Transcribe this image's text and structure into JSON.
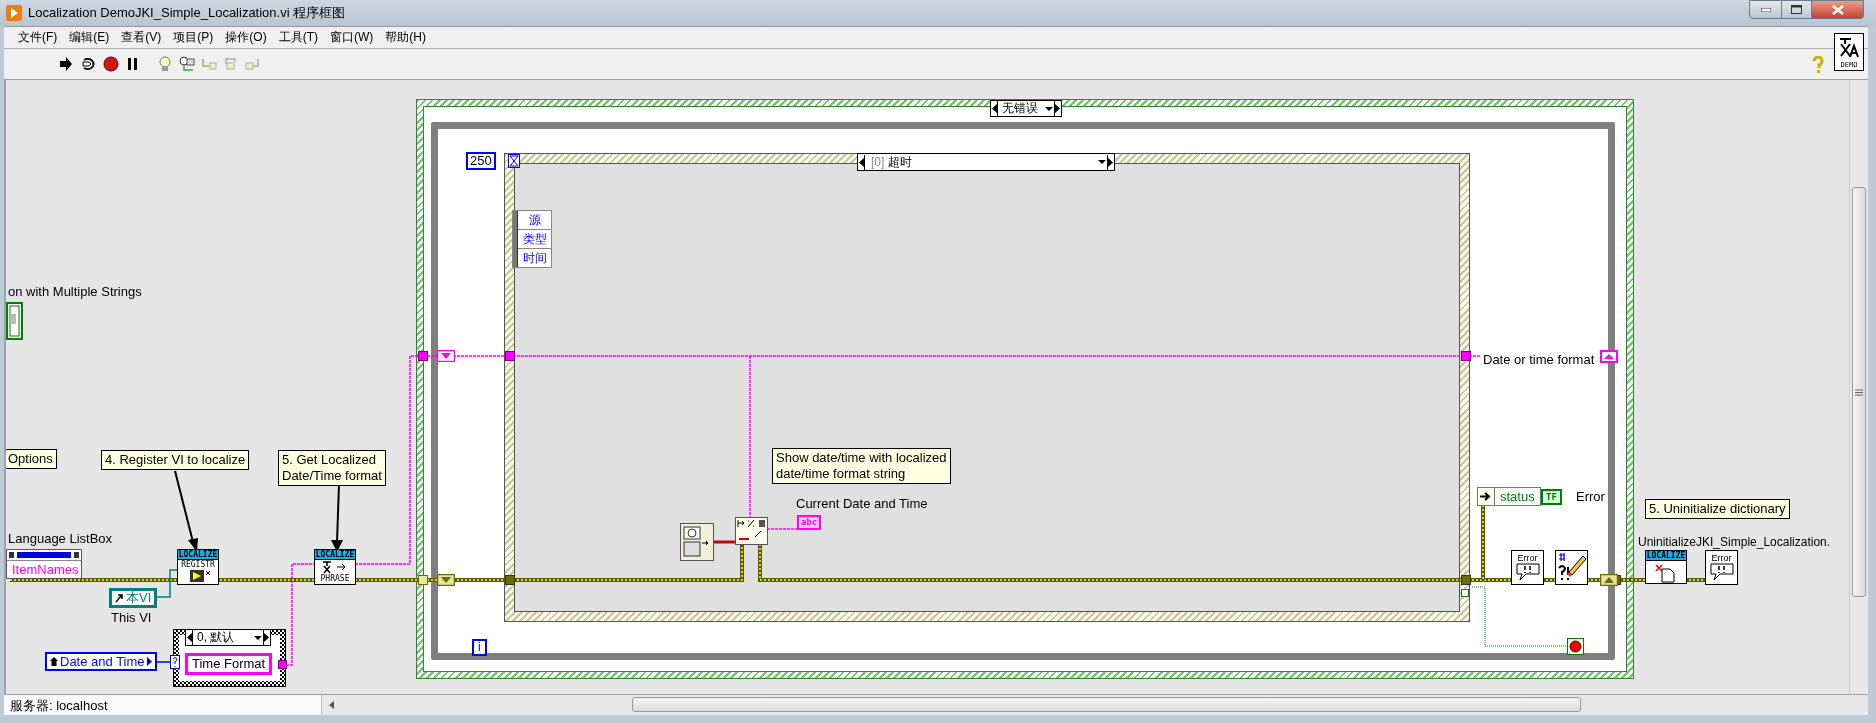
{
  "window": {
    "title": "Localization DemoJKI_Simple_Localization.vi 程序框图"
  },
  "menu": [
    {
      "label": "文件(F)"
    },
    {
      "label": "编辑(E)"
    },
    {
      "label": "查看(V)"
    },
    {
      "label": "项目(P)"
    },
    {
      "label": "操作(O)"
    },
    {
      "label": "工具(T)"
    },
    {
      "label": "窗口(W)"
    },
    {
      "label": "帮助(H)"
    }
  ],
  "vi_icon": {
    "caption": "DEMO"
  },
  "diagram": {
    "case_structure": {
      "selector": "无错误"
    },
    "while_loop": {
      "iteration": "i"
    },
    "event_structure": {
      "timeout": "250",
      "case_index": "[0]",
      "case_name": "超时",
      "event_data": [
        "源",
        "类型",
        "时间"
      ]
    },
    "partial_label": "on with Multiple Strings",
    "comments": [
      {
        "text": "Options"
      },
      {
        "text": "4. Register VI to localize"
      },
      {
        "text": "5. Get Localized\nDate/Time format"
      },
      {
        "text": "Show date/time with localized\ndate/time format string"
      },
      {
        "text": "5. Uninitialize dictionary"
      }
    ],
    "listbox_property": {
      "label": "Language ListBox",
      "property": "ItemNames"
    },
    "vi_reference": {
      "value": "本VI",
      "label": "This VI"
    },
    "date_time_control": {
      "label": "Date and Time"
    },
    "enum_case": {
      "selector": "0, 默认",
      "string": "Time Format"
    },
    "register_node": {
      "banner": "LOCALIZE",
      "caption": "REGISTR"
    },
    "phrase_node": {
      "banner": "LOCALIZE",
      "caption": "PHRASE"
    },
    "current_time_indicator": {
      "label": "Current Date and Time",
      "type": "abc"
    },
    "format_indicator": {
      "label": "Date or time format"
    },
    "unbundle": {
      "field": "status"
    },
    "error_indicator": {
      "type": "TF",
      "label": "Error"
    },
    "error_dialogs": [
      {
        "text": "Error"
      },
      {
        "text": "Error"
      }
    ],
    "uninit_node": {
      "label": "UninitializeJKI_Simple_Localization.",
      "banner": "LOCALIZE"
    }
  },
  "status_bar": {
    "text": "服务器: localhost"
  }
}
